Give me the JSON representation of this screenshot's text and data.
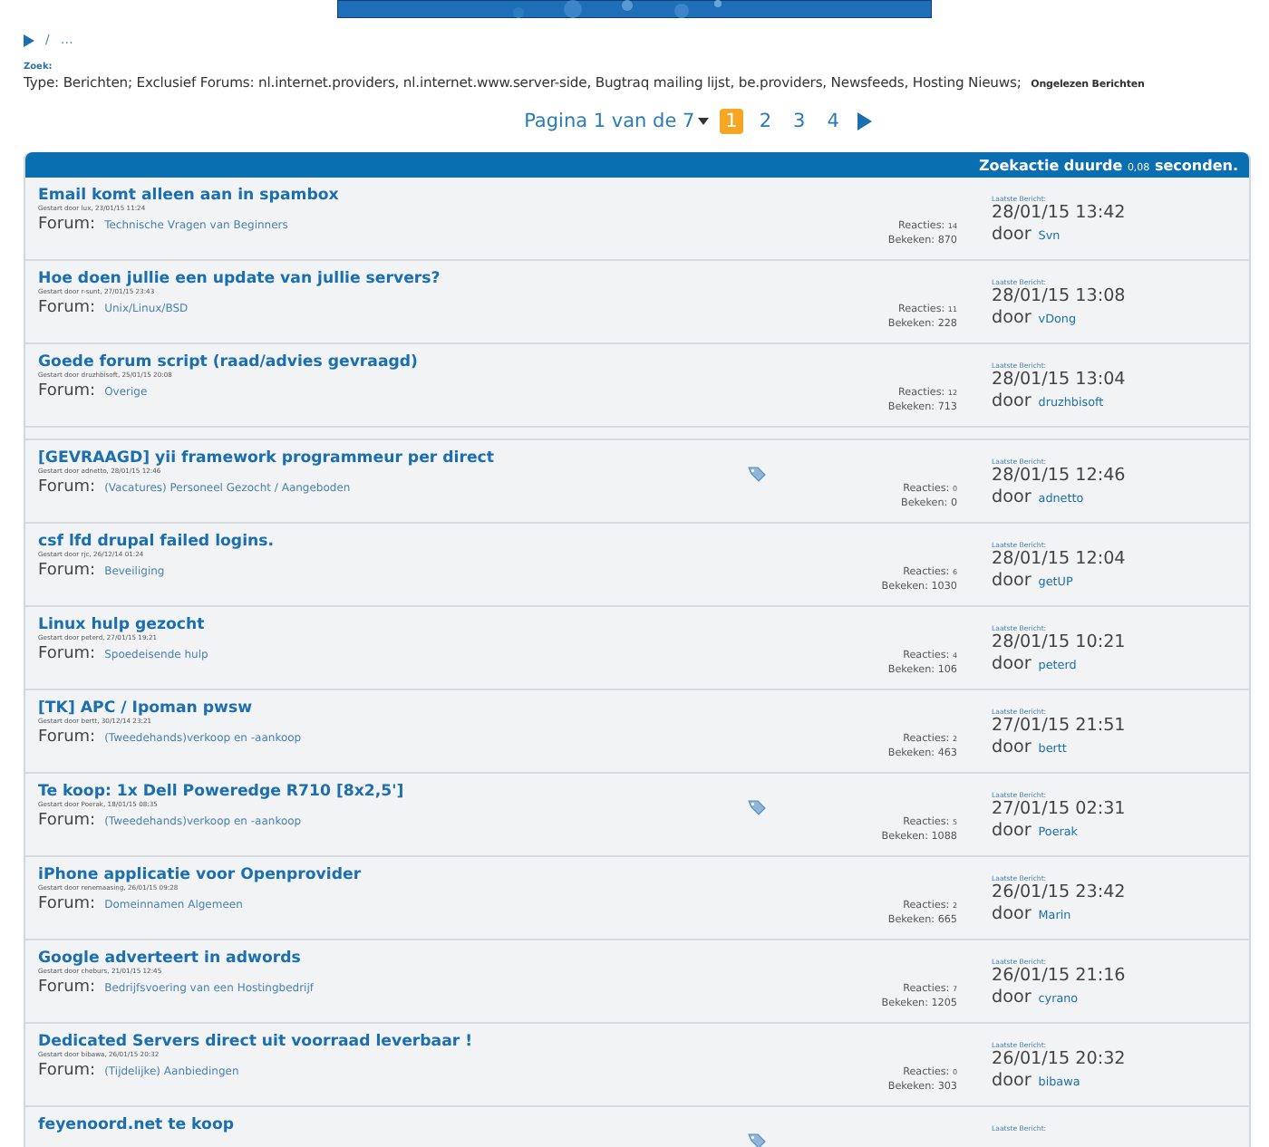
{
  "breadcrumb": {
    "separator": "/",
    "current": "…"
  },
  "search": {
    "label": "Zoek:",
    "criteria": "Type: Berichten; Exclusief Forums: nl.internet.providers, nl.internet.www.server-side, Bugtraq mailing lijst, be.providers, Newsfeeds, Hosting Nieuws;",
    "extra": "Ongelezen Berichten"
  },
  "pagination": {
    "label": "Pagina 1 van de 7",
    "pages": [
      {
        "label": "1",
        "selected": true
      },
      {
        "label": "2",
        "selected": false
      },
      {
        "label": "3",
        "selected": false
      },
      {
        "label": "4",
        "selected": false
      }
    ]
  },
  "results_header": {
    "prefix": "Zoekactie duurde",
    "time": "0,08",
    "suffix": "seconden."
  },
  "threads": [
    {
      "title": "Email komt alleen aan in spambox",
      "started": "Gestart door lux, 23/01/15 11:24",
      "forum_label": "Forum:",
      "forum": "Technische Vragen van Beginners",
      "tagged": false,
      "replies_label": "Reacties:",
      "replies": "14",
      "views_label": "Bekeken:",
      "views": "870",
      "last_label": "Laatste Bericht:",
      "last_date": "28/01/15 13:42",
      "by": "door",
      "last_user": "Svn"
    },
    {
      "title": "Hoe doen jullie een update van jullie servers?",
      "started": "Gestart door r-sunt, 27/01/15 23:43",
      "forum_label": "Forum:",
      "forum": "Unix/Linux/BSD",
      "tagged": false,
      "replies_label": "Reacties:",
      "replies": "11",
      "views_label": "Bekeken:",
      "views": "228",
      "last_label": "Laatste Bericht:",
      "last_date": "28/01/15 13:08",
      "by": "door",
      "last_user": "vDong"
    },
    {
      "title": "Goede forum script (raad/advies gevraagd)",
      "started": "Gestart door druzhbisoft, 25/01/15 20:08",
      "forum_label": "Forum:",
      "forum": "Overige",
      "tagged": false,
      "replies_label": "Reacties:",
      "replies": "12",
      "views_label": "Bekeken:",
      "views": "713",
      "last_label": "Laatste Bericht:",
      "last_date": "28/01/15 13:04",
      "by": "door",
      "last_user": "druzhbisoft"
    },
    {
      "title": "[GEVRAAGD] yii framework programmeur per direct",
      "started": "Gestart door adnetto, 28/01/15 12:46",
      "forum_label": "Forum:",
      "forum": "(Vacatures) Personeel Gezocht / Aangeboden",
      "tagged": true,
      "replies_label": "Reacties:",
      "replies": "0",
      "views_label": "Bekeken:",
      "views": "0",
      "last_label": "Laatste Bericht:",
      "last_date": "28/01/15 12:46",
      "by": "door",
      "last_user": "adnetto"
    },
    {
      "title": "csf lfd drupal failed logins.",
      "started": "Gestart door rjc, 26/12/14 01:24",
      "forum_label": "Forum:",
      "forum": "Beveiliging",
      "tagged": false,
      "replies_label": "Reacties:",
      "replies": "6",
      "views_label": "Bekeken:",
      "views": "1030",
      "last_label": "Laatste Bericht:",
      "last_date": "28/01/15 12:04",
      "by": "door",
      "last_user": "getUP"
    },
    {
      "title": "Linux hulp gezocht",
      "started": "Gestart door peterd, 27/01/15 19:21",
      "forum_label": "Forum:",
      "forum": "Spoedeisende hulp",
      "tagged": false,
      "replies_label": "Reacties:",
      "replies": "4",
      "views_label": "Bekeken:",
      "views": "106",
      "last_label": "Laatste Bericht:",
      "last_date": "28/01/15 10:21",
      "by": "door",
      "last_user": "peterd"
    },
    {
      "title": "[TK] APC / Ipoman pwsw",
      "started": "Gestart door bertt, 30/12/14 23:21",
      "forum_label": "Forum:",
      "forum": "(Tweedehands)verkoop en -aankoop",
      "tagged": false,
      "replies_label": "Reacties:",
      "replies": "2",
      "views_label": "Bekeken:",
      "views": "463",
      "last_label": "Laatste Bericht:",
      "last_date": "27/01/15 21:51",
      "by": "door",
      "last_user": "bertt"
    },
    {
      "title": "Te koop: 1x Dell Poweredge R710 [8x2,5']",
      "started": "Gestart door Poerak, 18/01/15 08:35",
      "forum_label": "Forum:",
      "forum": "(Tweedehands)verkoop en -aankoop",
      "tagged": true,
      "replies_label": "Reacties:",
      "replies": "5",
      "views_label": "Bekeken:",
      "views": "1088",
      "last_label": "Laatste Bericht:",
      "last_date": "27/01/15 02:31",
      "by": "door",
      "last_user": "Poerak"
    },
    {
      "title": "iPhone applicatie voor Openprovider",
      "started": "Gestart door renemaasing, 26/01/15 09:28",
      "forum_label": "Forum:",
      "forum": "Domeinnamen Algemeen",
      "tagged": false,
      "replies_label": "Reacties:",
      "replies": "2",
      "views_label": "Bekeken:",
      "views": "665",
      "last_label": "Laatste Bericht:",
      "last_date": "26/01/15 23:42",
      "by": "door",
      "last_user": "Marin"
    },
    {
      "title": "Google adverteert in adwords",
      "started": "Gestart door cheburs, 21/01/15 12:45",
      "forum_label": "Forum:",
      "forum": "Bedrijfsvoering van een Hostingbedrijf",
      "tagged": false,
      "replies_label": "Reacties:",
      "replies": "7",
      "views_label": "Bekeken:",
      "views": "1205",
      "last_label": "Laatste Bericht:",
      "last_date": "26/01/15 21:16",
      "by": "door",
      "last_user": "cyrano"
    },
    {
      "title": "Dedicated Servers direct uit voorraad leverbaar !",
      "started": "Gestart door bibawa, 26/01/15 20:32",
      "forum_label": "Forum:",
      "forum": "(Tijdelijke) Aanbiedingen",
      "tagged": false,
      "replies_label": "Reacties:",
      "replies": "0",
      "views_label": "Bekeken:",
      "views": "303",
      "last_label": "Laatste Bericht:",
      "last_date": "26/01/15 20:32",
      "by": "door",
      "last_user": "bibawa"
    },
    {
      "title": "feyenoord.net te koop",
      "tagged": true,
      "last_label": "Laatste Bericht:"
    }
  ]
}
